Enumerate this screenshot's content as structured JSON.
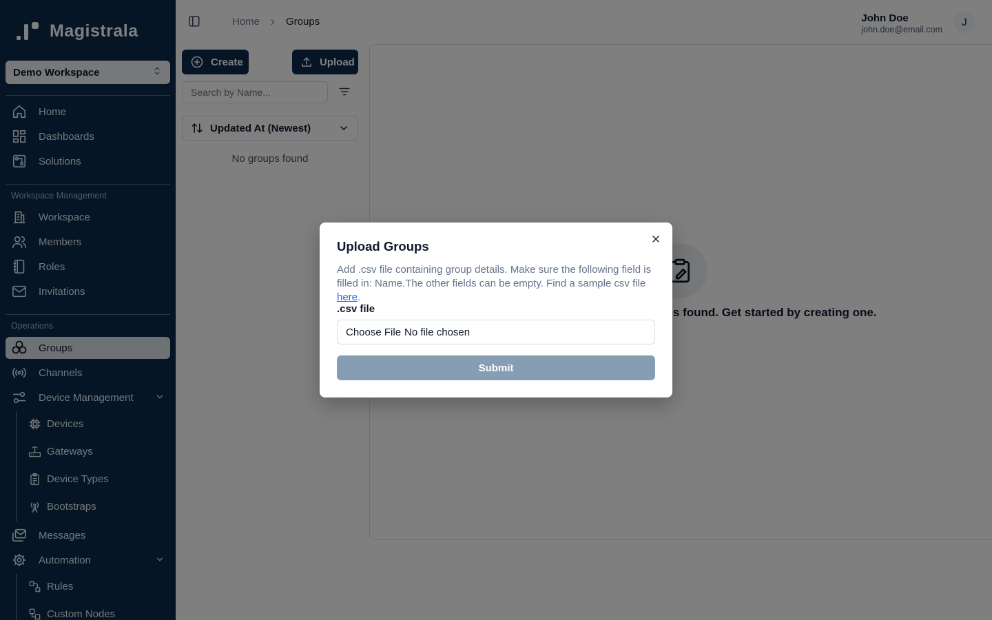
{
  "app": {
    "name": "Magistrala"
  },
  "workspace": {
    "selected": "Demo Workspace"
  },
  "sidebar": {
    "main_items": [
      {
        "label": "Home",
        "icon": "home-icon"
      },
      {
        "label": "Dashboards",
        "icon": "dashboard-icon"
      },
      {
        "label": "Solutions",
        "icon": "solutions-icon"
      }
    ],
    "workspace_section": "Workspace Management",
    "workspace_items": [
      {
        "label": "Workspace",
        "icon": "building-icon"
      },
      {
        "label": "Members",
        "icon": "users-icon"
      },
      {
        "label": "Roles",
        "icon": "book-icon"
      },
      {
        "label": "Invitations",
        "icon": "mail-icon"
      }
    ],
    "operations_section": "Operations",
    "operations_items": [
      {
        "label": "Groups",
        "icon": "groups-icon",
        "active": true
      },
      {
        "label": "Channels",
        "icon": "broadcast-icon"
      },
      {
        "label": "Device Management",
        "icon": "sliders-icon",
        "expandable": true
      }
    ],
    "device_sub_items": [
      {
        "label": "Devices",
        "icon": "cpu-icon"
      },
      {
        "label": "Gateways",
        "icon": "router-icon"
      },
      {
        "label": "Device Types",
        "icon": "clipboard-icon"
      },
      {
        "label": "Bootstraps",
        "icon": "antenna-icon"
      }
    ],
    "other_items": [
      {
        "label": "Messages",
        "icon": "messages-icon"
      },
      {
        "label": "Automation",
        "icon": "gear-icon",
        "expandable": true
      }
    ],
    "automation_sub_items": [
      {
        "label": "Rules",
        "icon": "rules-icon"
      },
      {
        "label": "Custom Nodes",
        "icon": "nodes-icon"
      }
    ]
  },
  "breadcrumb": {
    "home": "Home",
    "current": "Groups"
  },
  "user": {
    "name": "John Doe",
    "email": "john.doe@email.com",
    "initial": "J"
  },
  "toolbar": {
    "create_label": "Create",
    "upload_label": "Upload"
  },
  "search": {
    "placeholder": "Search by Name..."
  },
  "sort": {
    "label": "Updated At (Newest)"
  },
  "list": {
    "empty_text": "No groups found"
  },
  "panel": {
    "title": "No groups found. Get started by creating one.",
    "subtitle": ""
  },
  "modal": {
    "title": "Upload Groups",
    "description": "Add .csv file containing group details. Make sure the following field is filled in: Name.The other fields can be empty. Find a sample csv file ",
    "link_text": "here",
    "after_link": ".",
    "field_label": ".csv file",
    "file_button": "Choose File",
    "file_status": "No file chosen",
    "submit_label": "Submit"
  },
  "colors": {
    "sidebar_bg": "#0b2a4a",
    "primary": "#0b2a4a",
    "submit_disabled": "#869eb4",
    "link": "#2563eb"
  }
}
